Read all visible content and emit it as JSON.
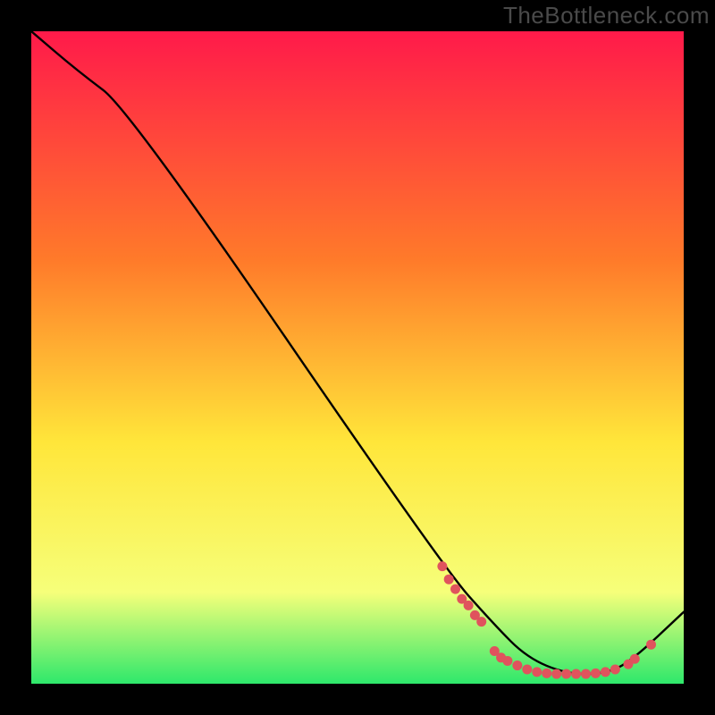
{
  "watermark": "TheBottleneck.com",
  "colors": {
    "gradient_top": "#ff1a4a",
    "gradient_mid1": "#ff7a2a",
    "gradient_mid2": "#ffe63a",
    "gradient_mid3": "#f6ff7a",
    "gradient_bottom": "#2ee86b",
    "curve": "#000000",
    "marker_fill": "#e0535d",
    "background": "#000000"
  },
  "chart_data": {
    "type": "line",
    "title": "",
    "xlabel": "",
    "ylabel": "",
    "xlim": [
      0,
      100
    ],
    "ylim": [
      0,
      100
    ],
    "series": [
      {
        "name": "curve",
        "x": [
          0,
          7,
          15,
          63,
          71,
          76,
          82,
          88,
          92,
          100
        ],
        "y": [
          100,
          94,
          88,
          18,
          9,
          4,
          1.5,
          1.5,
          3.5,
          11
        ]
      }
    ],
    "markers": [
      {
        "x": 63,
        "y": 18
      },
      {
        "x": 64,
        "y": 16
      },
      {
        "x": 65,
        "y": 14.5
      },
      {
        "x": 66,
        "y": 13
      },
      {
        "x": 67,
        "y": 12
      },
      {
        "x": 68,
        "y": 10.5
      },
      {
        "x": 69,
        "y": 9.5
      },
      {
        "x": 71,
        "y": 5
      },
      {
        "x": 72,
        "y": 4
      },
      {
        "x": 73,
        "y": 3.5
      },
      {
        "x": 74.5,
        "y": 2.8
      },
      {
        "x": 76,
        "y": 2.2
      },
      {
        "x": 77.5,
        "y": 1.8
      },
      {
        "x": 79,
        "y": 1.6
      },
      {
        "x": 80.5,
        "y": 1.5
      },
      {
        "x": 82,
        "y": 1.5
      },
      {
        "x": 83.5,
        "y": 1.5
      },
      {
        "x": 85,
        "y": 1.5
      },
      {
        "x": 86.5,
        "y": 1.6
      },
      {
        "x": 88,
        "y": 1.8
      },
      {
        "x": 89.5,
        "y": 2.2
      },
      {
        "x": 91.5,
        "y": 3
      },
      {
        "x": 92.5,
        "y": 3.8
      },
      {
        "x": 95,
        "y": 6
      }
    ]
  }
}
